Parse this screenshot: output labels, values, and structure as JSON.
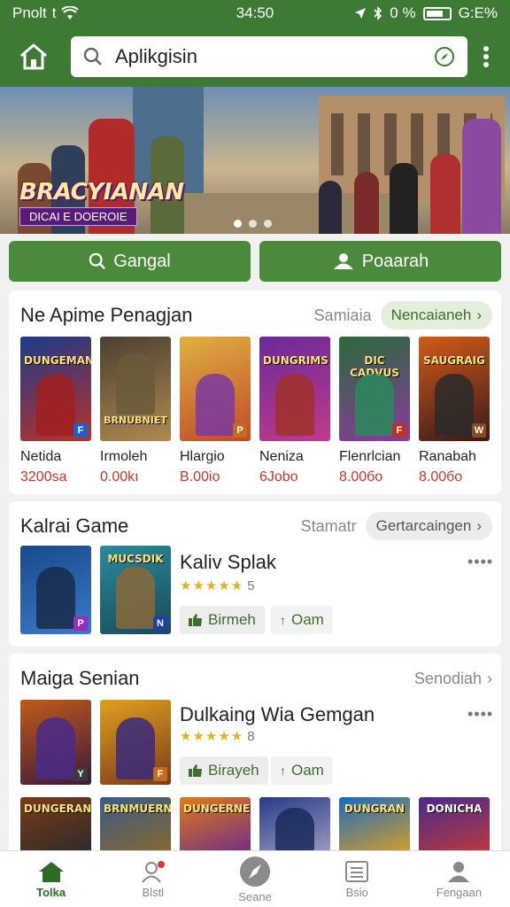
{
  "status": {
    "carrier": "Pnolt",
    "network": "t",
    "time": "34:50",
    "battery_text": "0 %",
    "right_text": "G:E%"
  },
  "appbar": {
    "search_value": "Aplikgisin"
  },
  "banner": {
    "logo_title": "BRACYIANAN",
    "logo_subtitle": "DICAI E DOEROIE",
    "dots": 3,
    "active_dot": 0
  },
  "actions": [
    {
      "label": "Gangal",
      "icon": "search-icon"
    },
    {
      "label": "Poaarah",
      "icon": "people-icon"
    }
  ],
  "section1": {
    "title": "Ne Apime Penagjan",
    "sub": "Samiaia",
    "pill": "Nencaianeh",
    "games": [
      {
        "name": "Netida",
        "price": "3200sa",
        "art": "DUNGEMAN",
        "badge": "F"
      },
      {
        "name": "Irmoleh",
        "price": "0.00kı",
        "art": "BRNUBNIET",
        "badge": ""
      },
      {
        "name": "Hlargio",
        "price": "B.00io",
        "art": "",
        "badge": "P"
      },
      {
        "name": "Neniza",
        "price": "6Jobo",
        "art": "DUNGRIMS",
        "badge": ""
      },
      {
        "name": "Flenrlcian",
        "price": "8.00бо",
        "art": "DIC CADVUS",
        "badge": "F"
      },
      {
        "name": "Ranabah",
        "price": "8.00бо",
        "art": "SAUGRAIG",
        "badge": "W"
      }
    ]
  },
  "section2": {
    "title": "Kalrai Game",
    "sub": "Stamatr",
    "pill": "Gertarcaingen",
    "feature_title": "Kaliv Splak",
    "stars": "★★★★★",
    "rating": "5",
    "tile_art": "MUCSDIK",
    "chip1": "Birmeh",
    "chip2": "Oam",
    "more": "••••"
  },
  "section3": {
    "title": "Maiga Senian",
    "link": "Senodiah",
    "feature_title": "Dulkaing Wia Gemgan",
    "stars": "★★★★★",
    "rating": "8",
    "chip1": "Birayeh",
    "chip2": "Oam",
    "more": "••••",
    "row_tiles": [
      "DUNGERANE",
      "BRNMUERNE",
      "DUNGERNE",
      "",
      "DUNGRAN",
      "DONICHA"
    ]
  },
  "nav": [
    {
      "label": "Tolka",
      "icon": "home-icon",
      "active": true
    },
    {
      "label": "Blstl",
      "icon": "profile-alert-icon",
      "active": false
    },
    {
      "label": "Seane",
      "icon": "compass-icon",
      "active": false
    },
    {
      "label": "Bsio",
      "icon": "list-icon",
      "active": false
    },
    {
      "label": "Fengaan",
      "icon": "user-icon",
      "active": false
    }
  ],
  "colors": {
    "primary": "#3d7a33",
    "button": "#4b8a3c",
    "price": "#c0392b",
    "star": "#e0b028"
  }
}
